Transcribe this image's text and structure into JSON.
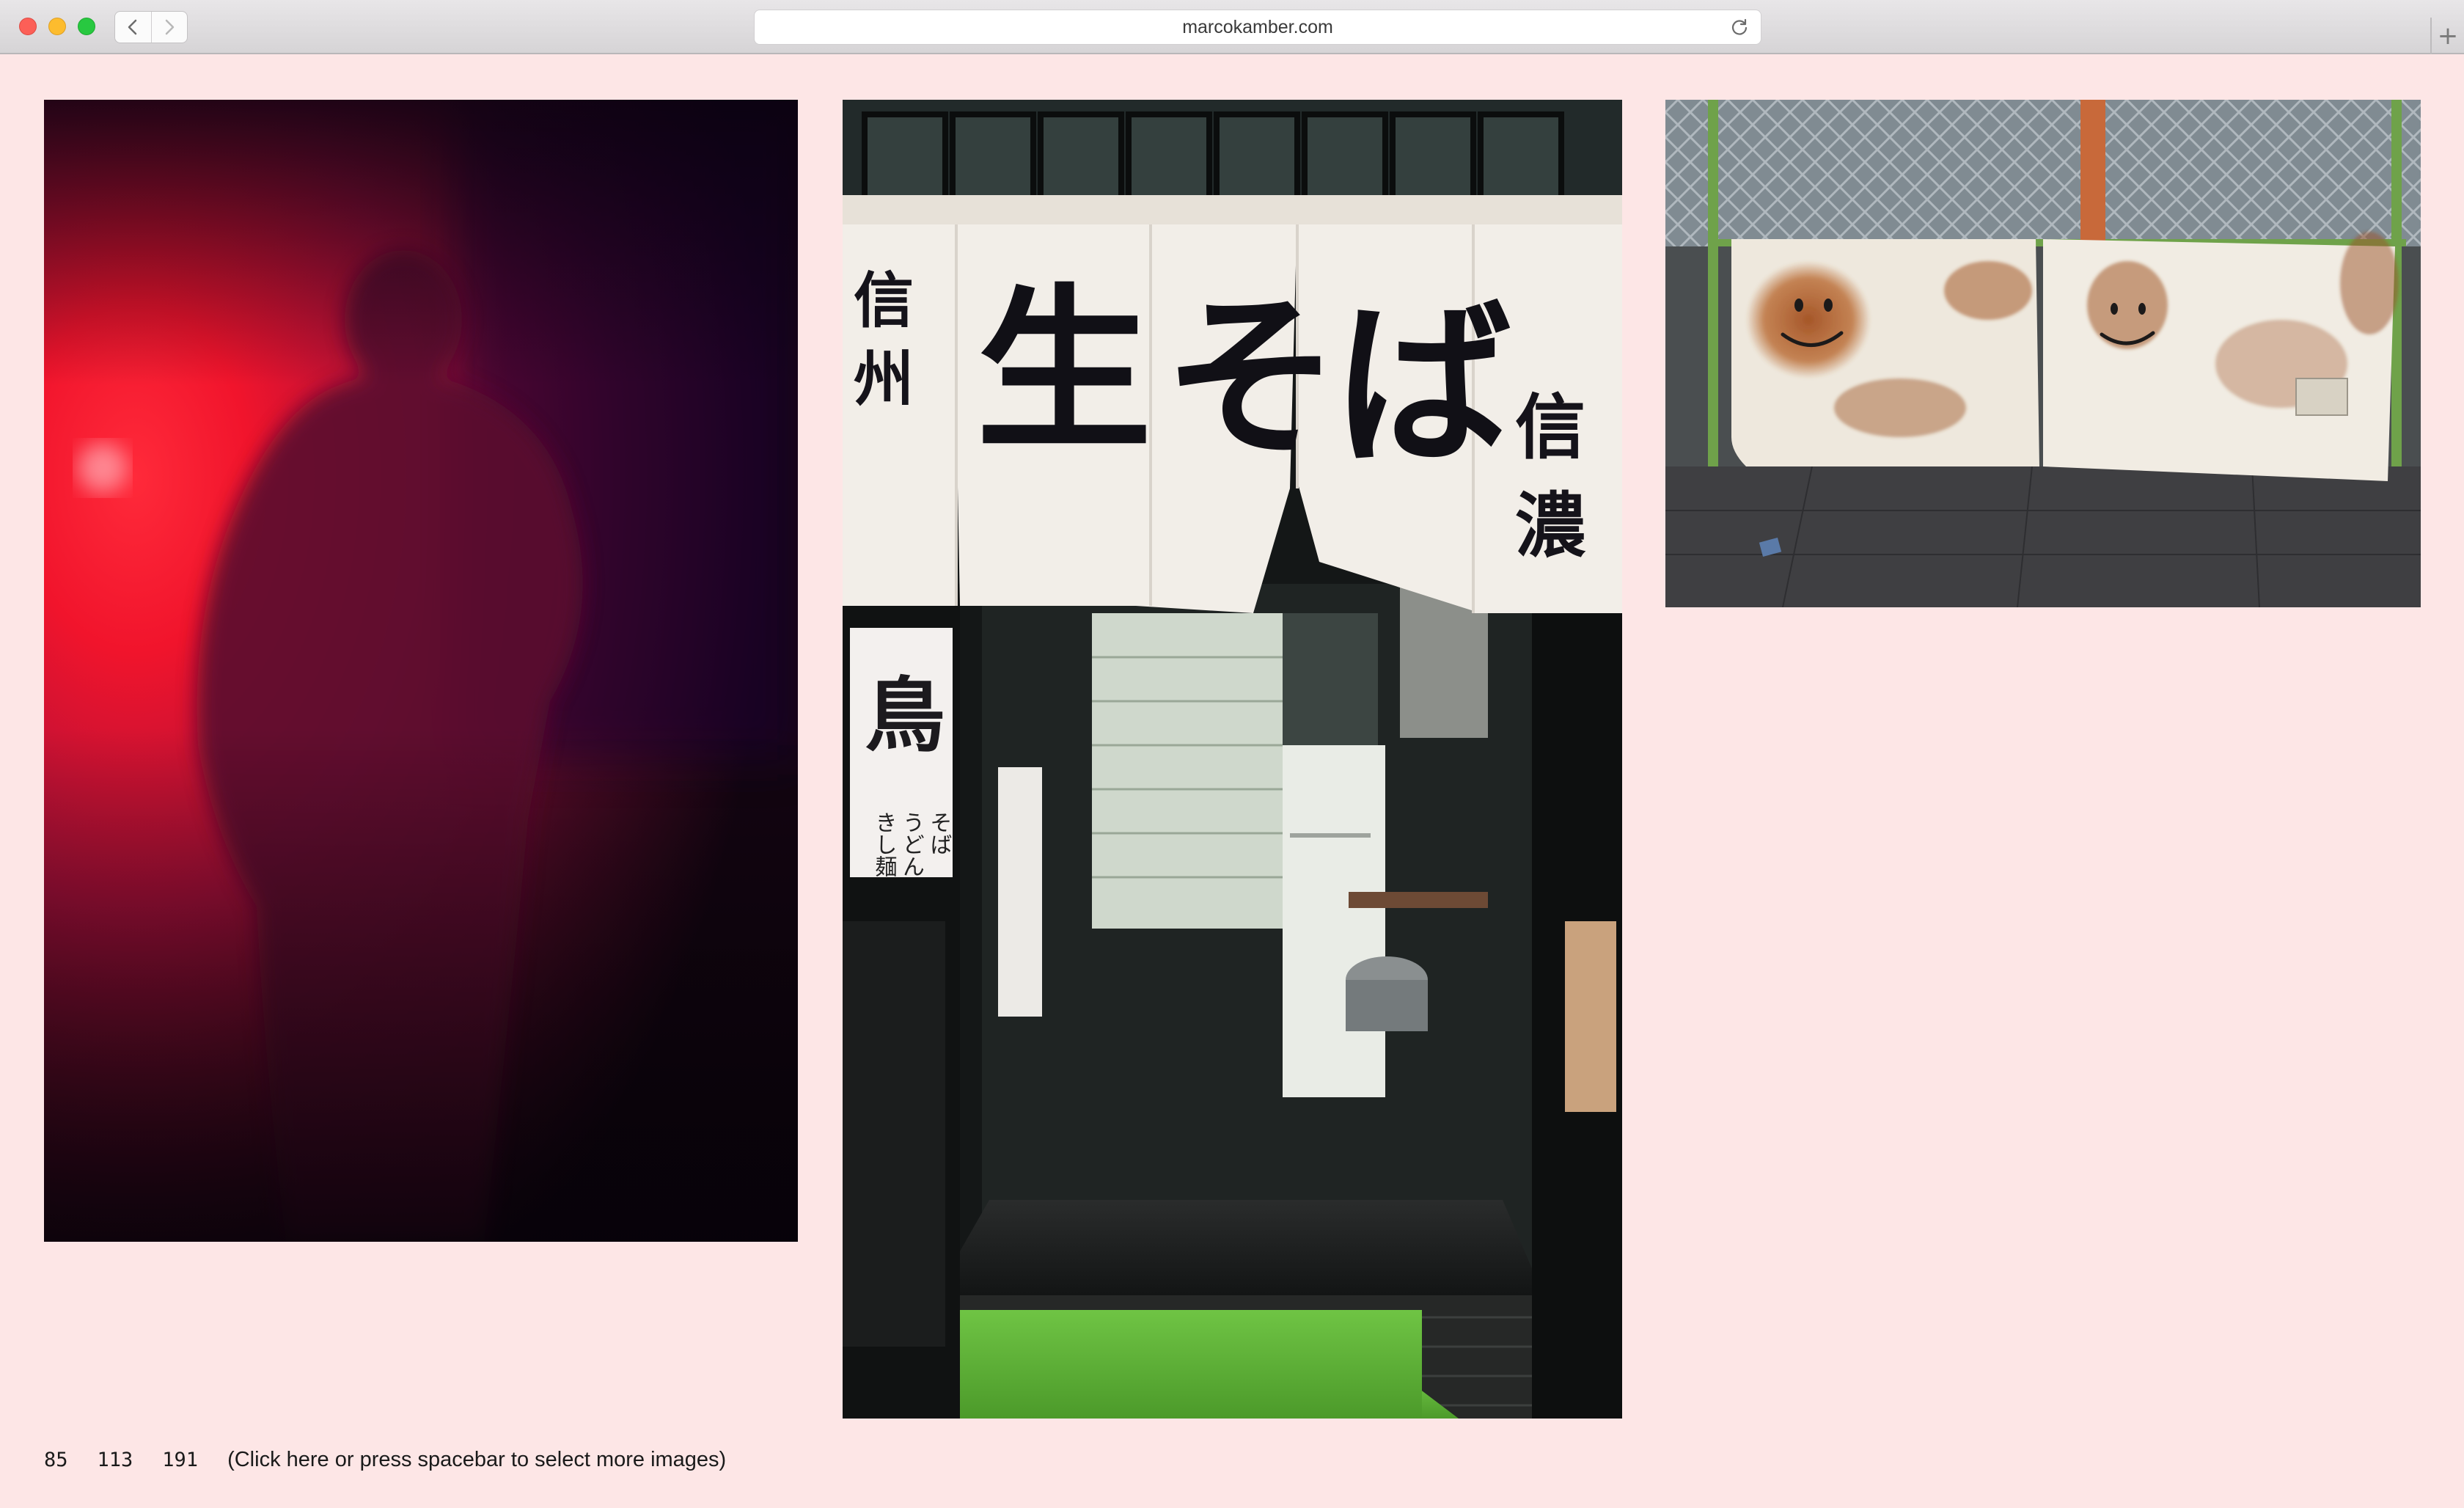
{
  "browser": {
    "url": "marcokamber.com",
    "new_tab_symbol": "+",
    "traffic_colors": {
      "close": "#fc5f57",
      "minimize": "#fdbc2e",
      "zoom": "#28c840"
    }
  },
  "gallery": {
    "photos": [
      {
        "subject": "silhouette of a person in red light"
      },
      {
        "subject": "noodle shop entrance with noren curtains"
      },
      {
        "subject": "rusty barriers with smiley faces behind chain-link fence"
      }
    ],
    "noren": {
      "left_lines": [
        "信",
        "州"
      ],
      "main": [
        "生",
        "そ",
        "ば"
      ],
      "right_lines": [
        "信",
        "濃"
      ],
      "wall_sign": "鳥",
      "menu_cols": [
        "そば",
        "うどん",
        "きし麺"
      ]
    }
  },
  "footer": {
    "numbers": [
      "85",
      "113",
      "191"
    ],
    "more_label": "(Click here or press spacebar to select more images)"
  },
  "colors": {
    "page_background": "#fde6e6",
    "text": "#1a1a1a"
  }
}
